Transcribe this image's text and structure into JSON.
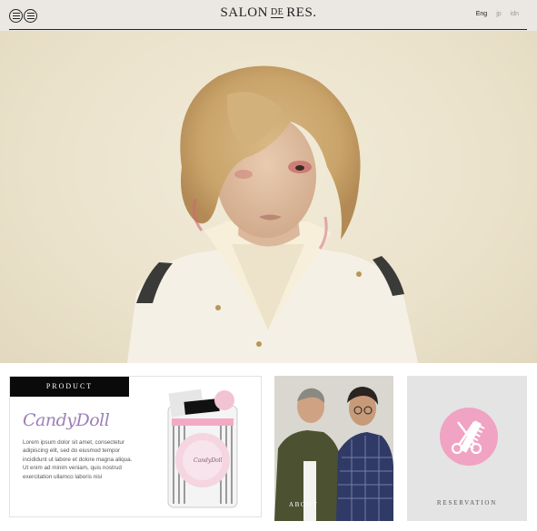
{
  "header": {
    "logo_main1": "SALON",
    "logo_de": "DE",
    "logo_main2": "RES.",
    "languages": [
      "Eng",
      "jp",
      "idn"
    ],
    "active_language": "Eng"
  },
  "product": {
    "tag": "PRODUCT",
    "brand": "CandyDoll",
    "description": "Lorem ipsum dolor sit amet, consectetur adipiscing elit, sed do eiusmod tempor incididunt ut labore et dolore magna aliqua. Ut enim ad minim veniam, quis nostrud exercitation ullamco laboris nisi",
    "package_brand": "CandyDoll"
  },
  "about": {
    "label": "ABOUT"
  },
  "reservation": {
    "label": "RESERVATION",
    "icon": "scissors-comb-icon"
  },
  "colors": {
    "header_bg": "#ebe8e3",
    "reservation_pink": "#f0a3c2",
    "brand_purple": "#9c7fb8"
  }
}
